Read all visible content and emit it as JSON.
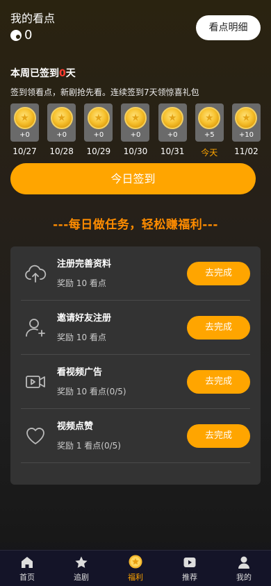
{
  "header": {
    "title": "我的看点",
    "points": "0",
    "detail_button": "看点明细"
  },
  "checkin": {
    "week_prefix": "本周已签到",
    "week_count": "0",
    "week_suffix": "天",
    "description": "签到领看点，新剧抢先看。连续签到7天领惊喜礼包",
    "days": [
      {
        "reward": "+0",
        "date": "10/27",
        "today": false
      },
      {
        "reward": "+0",
        "date": "10/28",
        "today": false
      },
      {
        "reward": "+0",
        "date": "10/29",
        "today": false
      },
      {
        "reward": "+0",
        "date": "10/30",
        "today": false
      },
      {
        "reward": "+0",
        "date": "10/31",
        "today": false
      },
      {
        "reward": "+5",
        "date": "今天",
        "today": true
      },
      {
        "reward": "+10",
        "date": "11/02",
        "today": false
      }
    ],
    "button": "今日签到"
  },
  "slogan": "---每日做任务，轻松赚福利---",
  "tasks": [
    {
      "name": "注册完善资料",
      "reward": "奖励 10 看点",
      "button": "去完成",
      "icon": "cloud-upload-icon"
    },
    {
      "name": "邀请好友注册",
      "reward": "奖励 10 看点",
      "button": "去完成",
      "icon": "add-user-icon"
    },
    {
      "name": "看视频广告",
      "reward": "奖励 10 看点(0/5)",
      "button": "去完成",
      "icon": "video-icon"
    },
    {
      "name": "视频点赞",
      "reward": "奖励 1 看点(0/5)",
      "button": "去完成",
      "icon": "heart-icon"
    }
  ],
  "tabbar": [
    {
      "label": "首页",
      "icon": "home-icon",
      "active": false
    },
    {
      "label": "追剧",
      "icon": "star-icon",
      "active": false
    },
    {
      "label": "福利",
      "icon": "coin-icon",
      "active": true
    },
    {
      "label": "推荐",
      "icon": "play-icon",
      "active": false
    },
    {
      "label": "我的",
      "icon": "user-icon",
      "active": false
    }
  ],
  "colors": {
    "accent": "#ffa500",
    "highlight_red": "#ff3b2f",
    "panel": "#333333",
    "tabbar": "#141428"
  }
}
